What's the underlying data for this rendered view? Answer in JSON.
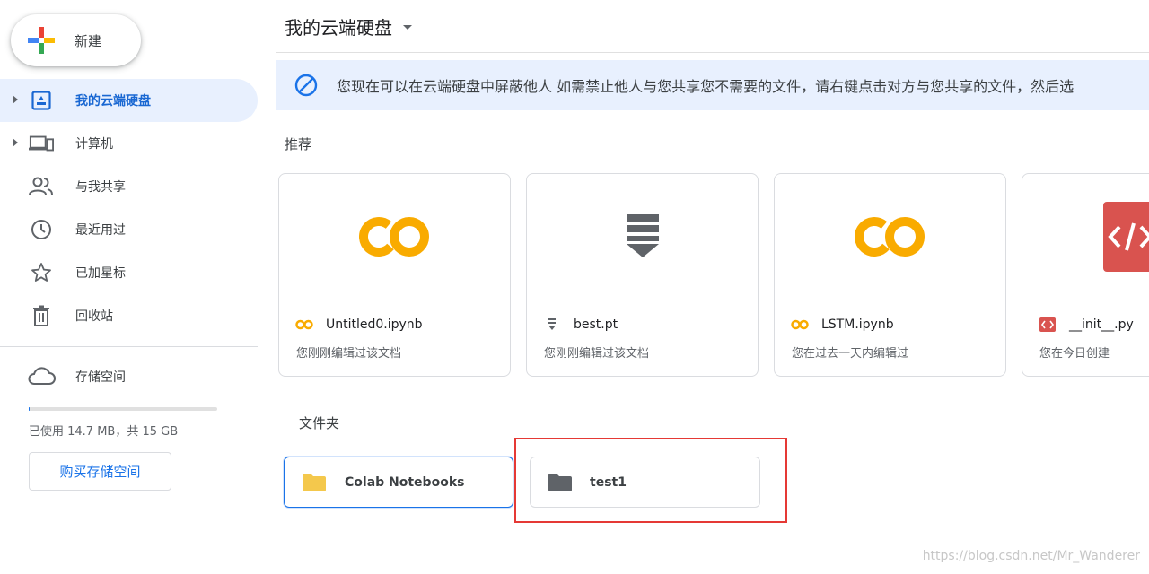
{
  "sidebar": {
    "new_label": "新建",
    "items": [
      {
        "label": "我的云端硬盘",
        "icon": "drive-icon",
        "active": true,
        "expandable": true
      },
      {
        "label": "计算机",
        "icon": "computers-icon",
        "active": false,
        "expandable": true
      },
      {
        "label": "与我共享",
        "icon": "shared-people-icon",
        "active": false,
        "expandable": false
      },
      {
        "label": "最近用过",
        "icon": "clock-icon",
        "active": false,
        "expandable": false
      },
      {
        "label": "已加星标",
        "icon": "star-icon",
        "active": false,
        "expandable": false
      },
      {
        "label": "回收站",
        "icon": "trash-icon",
        "active": false,
        "expandable": false
      }
    ],
    "storage_label": "存储空间",
    "storage_usage_text": "已使用 14.7 MB，共 15 GB",
    "storage_used_fraction": 0.001,
    "buy_storage_label": "购买存储空间"
  },
  "main": {
    "title": "我的云端硬盘",
    "banner_text": "您现在可以在云端硬盘中屏蔽他人 如需禁止他人与您共享您不需要的文件，请右键点击对方与您共享的文件，然后选",
    "recommended_label": "推荐",
    "recommended": [
      {
        "name": "Untitled0.ipynb",
        "subtitle": "您刚刚编辑过该文档",
        "type": "colab"
      },
      {
        "name": "best.pt",
        "subtitle": "您刚刚编辑过该文档",
        "type": "binary"
      },
      {
        "name": "LSTM.ipynb",
        "subtitle": "您在过去一天内编辑过",
        "type": "colab"
      },
      {
        "name": "__init__.py",
        "subtitle": "您在今日创建",
        "type": "code"
      }
    ],
    "folders_label": "文件夹",
    "folders": [
      {
        "name": "Colab Notebooks",
        "color": "#f4c84c",
        "selected": true
      },
      {
        "name": "test1",
        "color": "#5f6368",
        "selected": false
      }
    ]
  },
  "watermark": "https://blog.csdn.net/Mr_Wanderer",
  "colors": {
    "accent": "#1a73e8",
    "active_bg": "#e8f0fe",
    "colab_yellow": "#f9ab00",
    "highlight_red": "#e53935"
  }
}
